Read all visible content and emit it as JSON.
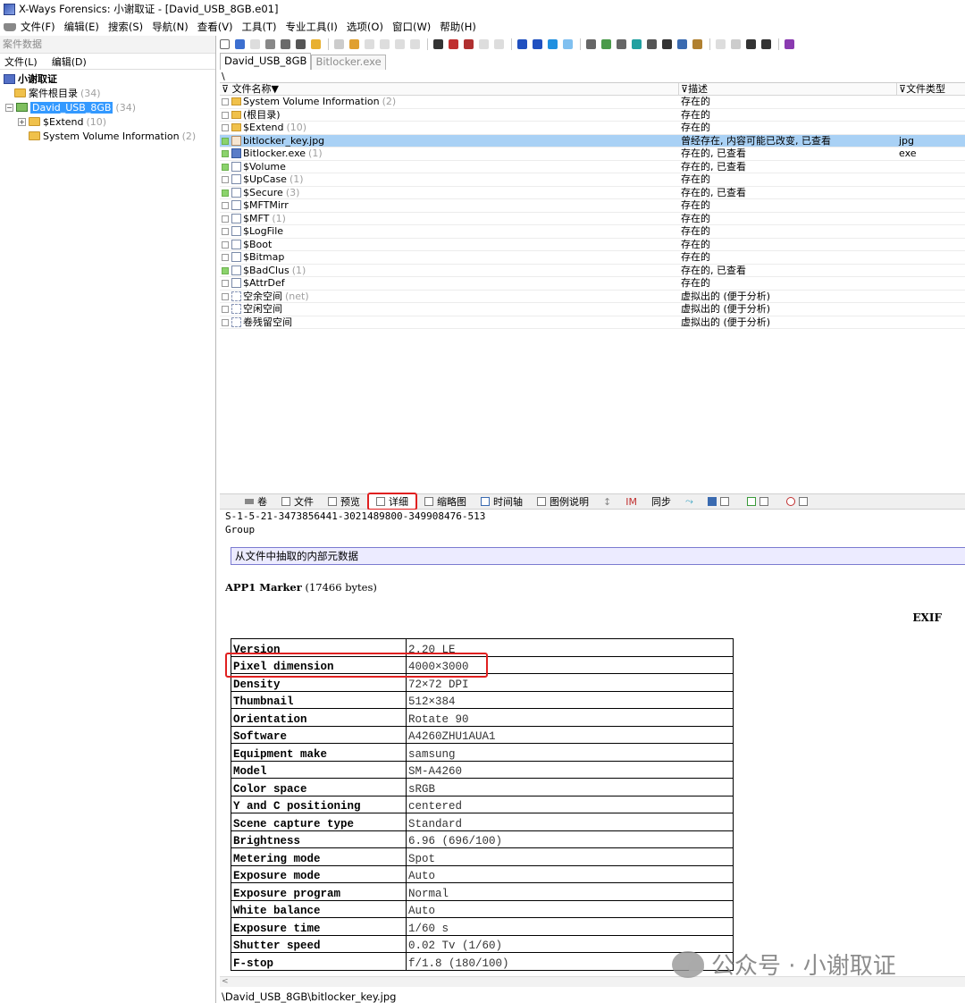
{
  "window": {
    "title": "X-Ways Forensics: 小谢取证 - [David_USB_8GB.e01]"
  },
  "menubar": {
    "items": [
      "文件(F)",
      "编辑(E)",
      "搜索(S)",
      "导航(N)",
      "查看(V)",
      "工具(T)",
      "专业工具(I)",
      "选项(O)",
      "窗口(W)",
      "帮助(H)"
    ]
  },
  "left_pane": {
    "header": "案件数据",
    "menu": [
      "文件(L)",
      "编辑(D)"
    ],
    "tree": {
      "case": "小谢取证",
      "case_root": {
        "label": "案件根目录",
        "count": "(34)"
      },
      "disk": {
        "label": "David_USB_8GB",
        "count": "(34)"
      },
      "extend": {
        "label": "$Extend",
        "count": "(10)"
      },
      "svi": {
        "label": "System Volume Information",
        "count": "(2)"
      }
    }
  },
  "tabs": [
    {
      "label": "David_USB_8GB",
      "active": true
    },
    {
      "label": "Bitlocker.exe",
      "active": false
    }
  ],
  "path": "\\",
  "file_list": {
    "columns": {
      "name": "文件名称▼",
      "desc": "描述",
      "type": "文件类型"
    },
    "rows": [
      {
        "icon": "folder-icon",
        "green": false,
        "name": "System Volume Information",
        "count": "(2)",
        "desc": "存在的",
        "type": ""
      },
      {
        "icon": "folder-icon",
        "green": false,
        "name": "(根目录)",
        "count": "",
        "desc": "存在的",
        "type": ""
      },
      {
        "icon": "folder-icon",
        "green": false,
        "name": "$Extend",
        "count": "(10)",
        "desc": "存在的",
        "type": ""
      },
      {
        "icon": "image-file-icon",
        "green": true,
        "name": "bitlocker_key.jpg",
        "count": "",
        "desc": "曾经存在, 内容可能已改变, 已查看",
        "type": "jpg",
        "selected": true
      },
      {
        "icon": "exe-file-icon",
        "green": true,
        "name": "Bitlocker.exe",
        "count": "(1)",
        "desc": "存在的, 已查看",
        "type": "exe"
      },
      {
        "icon": "file-icon",
        "green": true,
        "name": "$Volume",
        "count": "",
        "desc": "存在的, 已查看",
        "type": ""
      },
      {
        "icon": "file-icon",
        "green": false,
        "name": "$UpCase",
        "count": "(1)",
        "desc": "存在的",
        "type": ""
      },
      {
        "icon": "file-icon",
        "green": true,
        "name": "$Secure",
        "count": "(3)",
        "desc": "存在的, 已查看",
        "type": ""
      },
      {
        "icon": "file-icon",
        "green": false,
        "name": "$MFTMirr",
        "count": "",
        "desc": "存在的",
        "type": ""
      },
      {
        "icon": "file-icon",
        "green": false,
        "name": "$MFT",
        "count": "(1)",
        "desc": "存在的",
        "type": ""
      },
      {
        "icon": "file-icon",
        "green": false,
        "name": "$LogFile",
        "count": "",
        "desc": "存在的",
        "type": ""
      },
      {
        "icon": "file-icon",
        "green": false,
        "name": "$Boot",
        "count": "",
        "desc": "存在的",
        "type": ""
      },
      {
        "icon": "file-icon",
        "green": false,
        "name": "$Bitmap",
        "count": "",
        "desc": "存在的",
        "type": ""
      },
      {
        "icon": "file-icon",
        "green": true,
        "name": "$BadClus",
        "count": "(1)",
        "desc": "存在的, 已查看",
        "type": ""
      },
      {
        "icon": "file-icon",
        "green": false,
        "name": "$AttrDef",
        "count": "",
        "desc": "存在的",
        "type": ""
      },
      {
        "icon": "virtual-file-icon",
        "green": false,
        "name": "空余空间",
        "count": "(net)",
        "desc": "虚拟出的 (便于分析)",
        "type": ""
      },
      {
        "icon": "virtual-file-icon",
        "green": false,
        "name": "空闲空间",
        "count": "",
        "desc": "虚拟出的 (便于分析)",
        "type": ""
      },
      {
        "icon": "virtual-file-icon",
        "green": false,
        "name": "卷残留空间",
        "count": "",
        "desc": "虚拟出的 (便于分析)",
        "type": ""
      }
    ]
  },
  "view_tabs": [
    "卷",
    "文件",
    "预览",
    "详细",
    "缩略图",
    "时间轴",
    "图例说明",
    "IM",
    "同步"
  ],
  "detail": {
    "sid": "S-1-5-21-3473856441-3021489800-349908476-513",
    "group": "Group",
    "meta_header": "从文件中抽取的内部元数据",
    "app1_label": "APP1 Marker",
    "app1_size": "(17466 bytes)",
    "exif_label": "EXIF",
    "exif": [
      {
        "k": "Version",
        "v": "2.20 LE"
      },
      {
        "k": "Pixel dimension",
        "v": "4000×3000"
      },
      {
        "k": "Density",
        "v": "72×72 DPI"
      },
      {
        "k": "Thumbnail",
        "v": "512×384"
      },
      {
        "k": "Orientation",
        "v": "Rotate 90"
      },
      {
        "k": "Software",
        "v": "A4260ZHU1AUA1"
      },
      {
        "k": "Equipment make",
        "v": "samsung"
      },
      {
        "k": "Model",
        "v": "SM-A4260"
      },
      {
        "k": "Color space",
        "v": "sRGB"
      },
      {
        "k": "Y and C positioning",
        "v": "centered"
      },
      {
        "k": "Scene capture type",
        "v": "Standard"
      },
      {
        "k": "Brightness",
        "v": "6.96 (696/100)"
      },
      {
        "k": "Metering mode",
        "v": "Spot"
      },
      {
        "k": "Exposure mode",
        "v": "Auto"
      },
      {
        "k": "Exposure program",
        "v": "Normal"
      },
      {
        "k": "White balance",
        "v": "Auto"
      },
      {
        "k": "Exposure time",
        "v": "1/60 s"
      },
      {
        "k": "Shutter speed",
        "v": "0.02 Tv (1/60)"
      },
      {
        "k": "F-stop",
        "v": "f/1.8 (180/100)"
      }
    ]
  },
  "status": {
    "path": "\\David_USB_8GB\\bitlocker_key.jpg"
  },
  "watermark": {
    "text": "公众号 · 小谢取证"
  },
  "colors": {
    "selection": "#a9d1f5",
    "highlight": "#e02020",
    "meta_header_bg": "#ecebff"
  }
}
